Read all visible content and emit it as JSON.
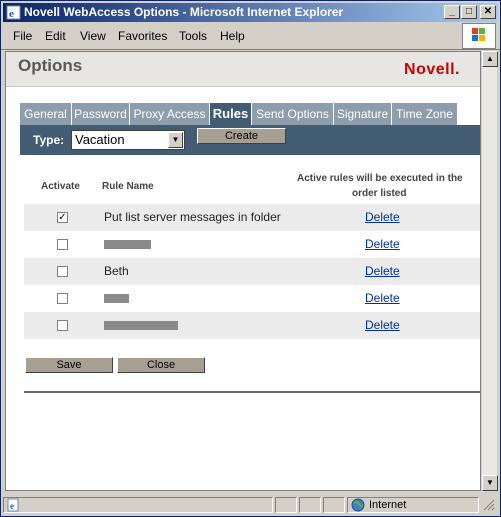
{
  "window": {
    "title": "Novell WebAccess Options - Microsoft Internet Explorer",
    "controls": {
      "minimize": "_",
      "maximize": "□",
      "close": "✕"
    }
  },
  "menu": [
    "File",
    "Edit",
    "View",
    "Favorites",
    "Tools",
    "Help"
  ],
  "header": {
    "title": "Options",
    "brand": "Novell."
  },
  "tabs": [
    {
      "label": "General",
      "active": false
    },
    {
      "label": "Password",
      "active": false
    },
    {
      "label": "Proxy Access",
      "active": false
    },
    {
      "label": "Rules",
      "active": true
    },
    {
      "label": "Send Options",
      "active": false
    },
    {
      "label": "Signature",
      "active": false
    },
    {
      "label": "Time Zone",
      "active": false
    }
  ],
  "typebar": {
    "label": "Type:",
    "selected": "Vacation",
    "create_label": "Create"
  },
  "table": {
    "col_activate": "Activate",
    "col_rule_name": "Rule Name",
    "col_note_1": "Active rules will be executed in the",
    "col_note_2": "order listed",
    "rows": [
      {
        "checked": true,
        "name": "Put list server messages in folder",
        "redacted": false,
        "delete": "Delete"
      },
      {
        "checked": false,
        "name": "",
        "redacted": true,
        "delete": "Delete"
      },
      {
        "checked": false,
        "name": "Beth",
        "redacted": false,
        "delete": "Delete"
      },
      {
        "checked": false,
        "name": "",
        "redacted": true,
        "delete": "Delete"
      },
      {
        "checked": false,
        "name": "",
        "redacted": true,
        "delete": "Delete"
      }
    ]
  },
  "buttons": {
    "save": "Save",
    "close": "Close"
  },
  "status": {
    "zone": "Internet"
  },
  "colors": {
    "tab_inactive": "#8d9dac",
    "tab_active": "#415c73",
    "brand_red": "#cc0000",
    "link": "#00309c"
  }
}
